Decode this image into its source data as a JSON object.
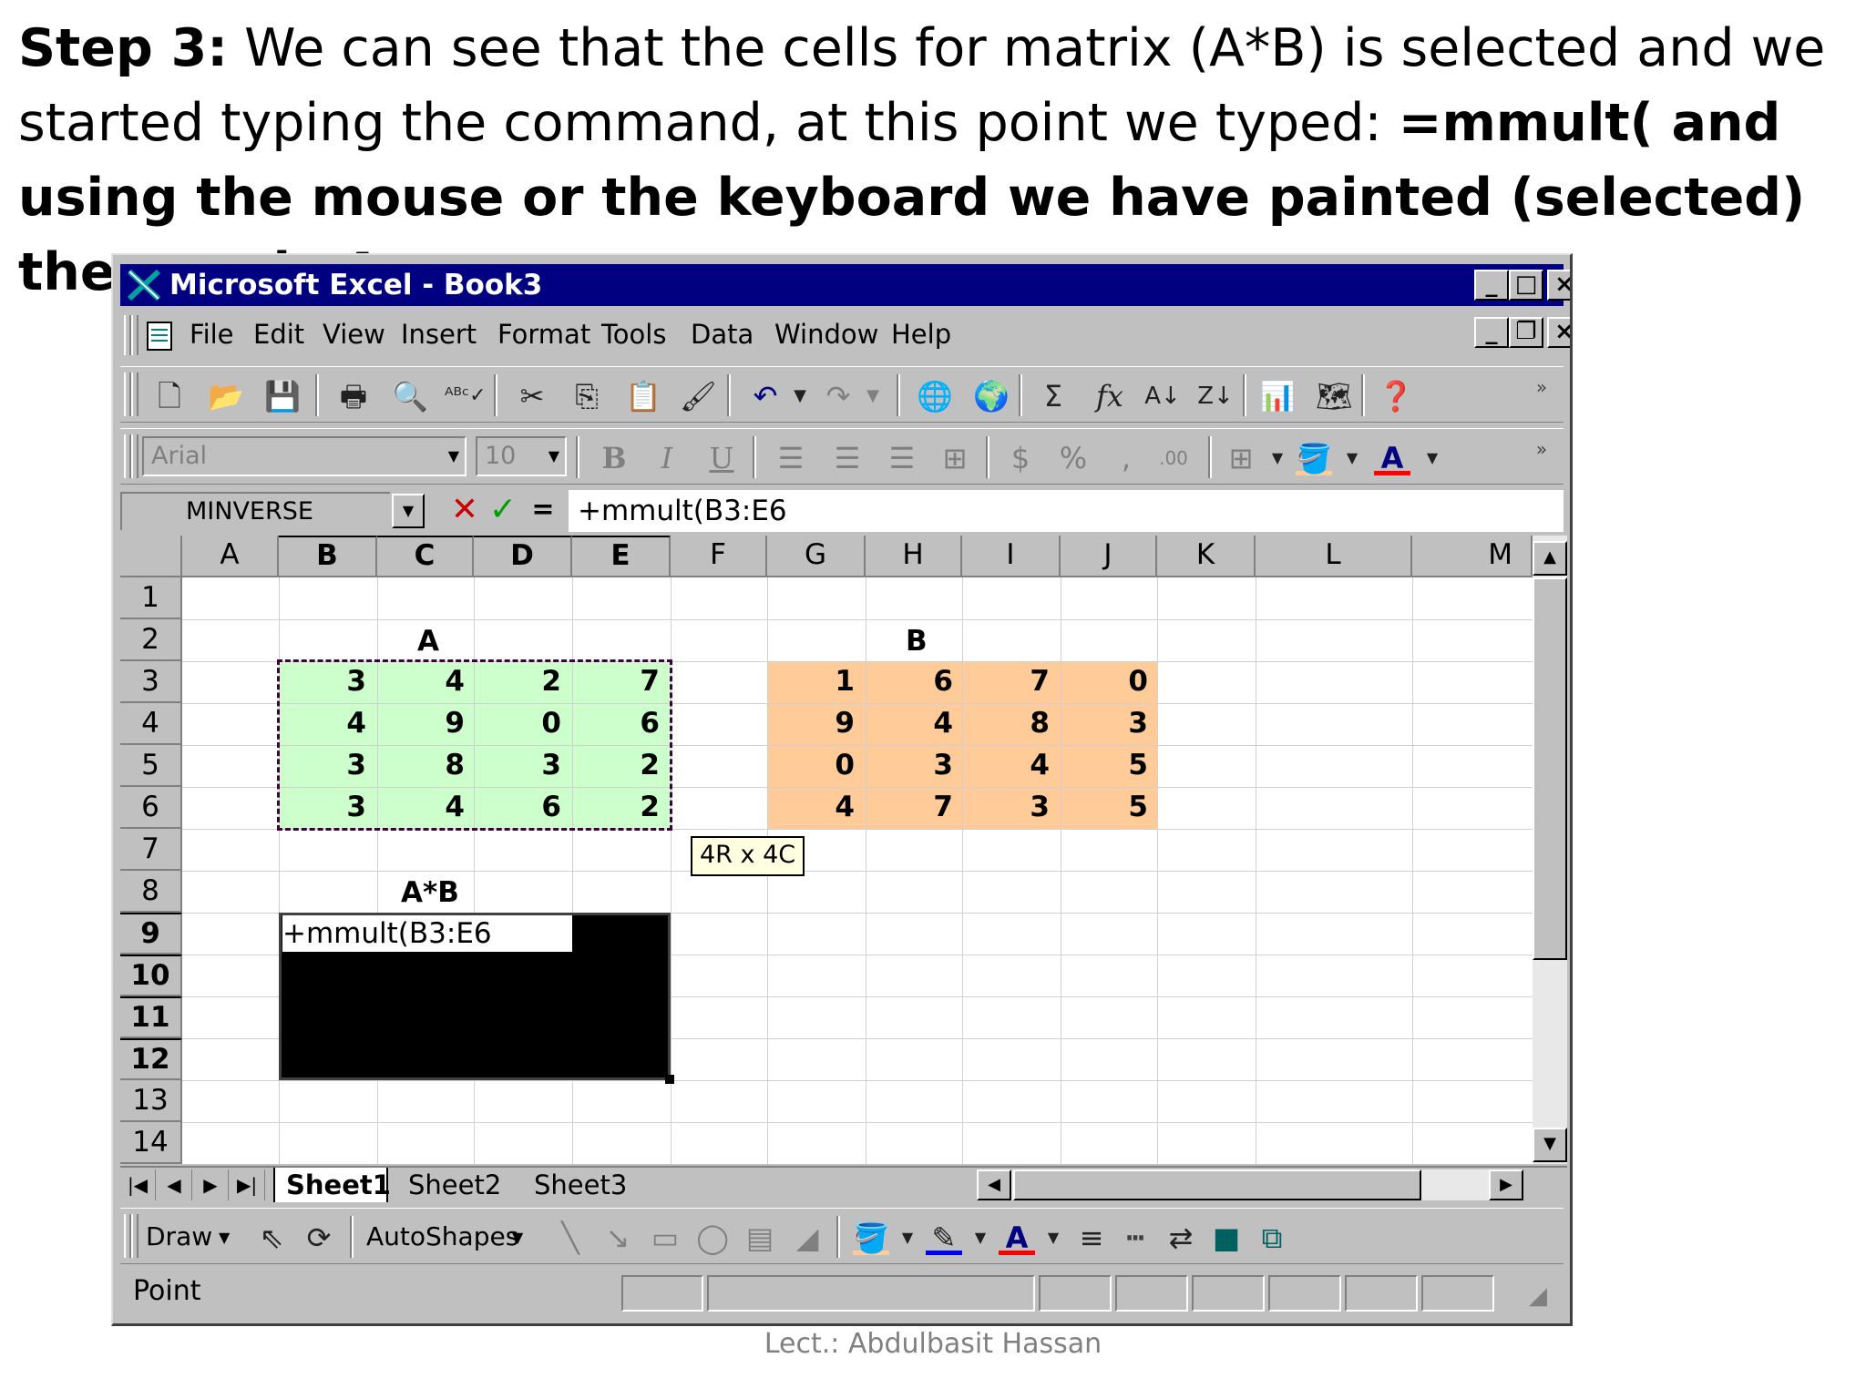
{
  "caption": {
    "lead": "Step 3:",
    "text1": " We can see that the cells for matrix (A*B) is selected and we started typing the command, at this point we typed: ",
    "bold2": "=mmult( and using the mouse or the keyboard we have painted (selected) the matrix A."
  },
  "window": {
    "title": "Microsoft Excel - Book3",
    "menu": [
      "File",
      "Edit",
      "View",
      "Insert",
      "Format",
      "Tools",
      "Data",
      "Window",
      "Help"
    ],
    "font_name": "Arial",
    "font_size": "10",
    "name_box": "MINVERSE",
    "formula": "+mmult(B3:E6",
    "columns": [
      "A",
      "B",
      "C",
      "D",
      "E",
      "F",
      "G",
      "H",
      "I",
      "J",
      "K",
      "L",
      "M"
    ],
    "rows": [
      "1",
      "2",
      "3",
      "4",
      "5",
      "6",
      "7",
      "8",
      "9",
      "10",
      "11",
      "12",
      "13",
      "14"
    ],
    "label_a": "A",
    "label_b": "B",
    "label_ab": "A*B",
    "matrix_a": [
      [
        "3",
        "4",
        "2",
        "7"
      ],
      [
        "4",
        "9",
        "0",
        "6"
      ],
      [
        "3",
        "8",
        "3",
        "2"
      ],
      [
        "3",
        "4",
        "6",
        "2"
      ]
    ],
    "matrix_b": [
      [
        "1",
        "6",
        "7",
        "0"
      ],
      [
        "9",
        "4",
        "8",
        "3"
      ],
      [
        "0",
        "3",
        "4",
        "5"
      ],
      [
        "4",
        "7",
        "3",
        "5"
      ]
    ],
    "cell_edit": "+mmult(B3:E6",
    "range_tip": "4R x 4C",
    "sheets": [
      "Sheet1",
      "Sheet2",
      "Sheet3"
    ],
    "draw_label": "Draw",
    "autoshapes_label": "AutoShapes",
    "status": "Point"
  },
  "footer": "Lect.: Abdulbasit Hassan",
  "colors": {
    "matrix_a_fill": "#ccffcc",
    "matrix_b_fill": "#ffcc99",
    "title_bar": "#000080"
  },
  "icons": [
    "new-icon",
    "open-icon",
    "save-icon",
    "print-icon",
    "preview-icon",
    "spelling-icon",
    "cut-icon",
    "copy-icon",
    "paste-icon",
    "format-painter-icon",
    "undo-icon",
    "redo-icon",
    "hyperlink-icon",
    "web-icon",
    "autosum-icon",
    "function-icon",
    "sort-asc-icon",
    "sort-desc-icon",
    "chart-wizard-icon",
    "map-icon",
    "help-icon"
  ]
}
